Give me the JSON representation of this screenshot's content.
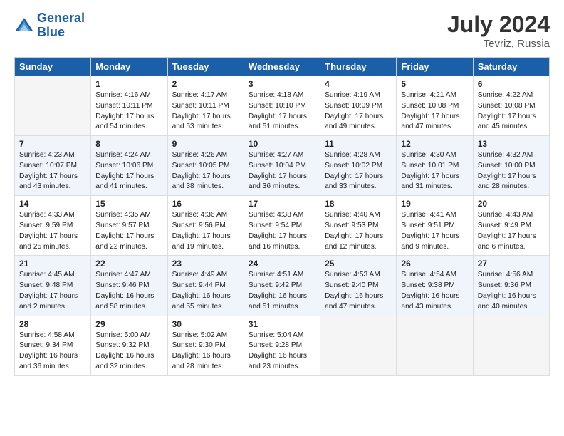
{
  "header": {
    "logo_line1": "General",
    "logo_line2": "Blue",
    "month_title": "July 2024",
    "location": "Tevriz, Russia"
  },
  "days_of_week": [
    "Sunday",
    "Monday",
    "Tuesday",
    "Wednesday",
    "Thursday",
    "Friday",
    "Saturday"
  ],
  "weeks": [
    {
      "row_class": "row-week1",
      "days": [
        {
          "num": "",
          "info": "",
          "empty": true
        },
        {
          "num": "1",
          "info": "Sunrise: 4:16 AM\nSunset: 10:11 PM\nDaylight: 17 hours\nand 54 minutes."
        },
        {
          "num": "2",
          "info": "Sunrise: 4:17 AM\nSunset: 10:11 PM\nDaylight: 17 hours\nand 53 minutes."
        },
        {
          "num": "3",
          "info": "Sunrise: 4:18 AM\nSunset: 10:10 PM\nDaylight: 17 hours\nand 51 minutes."
        },
        {
          "num": "4",
          "info": "Sunrise: 4:19 AM\nSunset: 10:09 PM\nDaylight: 17 hours\nand 49 minutes."
        },
        {
          "num": "5",
          "info": "Sunrise: 4:21 AM\nSunset: 10:08 PM\nDaylight: 17 hours\nand 47 minutes."
        },
        {
          "num": "6",
          "info": "Sunrise: 4:22 AM\nSunset: 10:08 PM\nDaylight: 17 hours\nand 45 minutes."
        }
      ]
    },
    {
      "row_class": "row-week2",
      "days": [
        {
          "num": "7",
          "info": "Sunrise: 4:23 AM\nSunset: 10:07 PM\nDaylight: 17 hours\nand 43 minutes."
        },
        {
          "num": "8",
          "info": "Sunrise: 4:24 AM\nSunset: 10:06 PM\nDaylight: 17 hours\nand 41 minutes."
        },
        {
          "num": "9",
          "info": "Sunrise: 4:26 AM\nSunset: 10:05 PM\nDaylight: 17 hours\nand 38 minutes."
        },
        {
          "num": "10",
          "info": "Sunrise: 4:27 AM\nSunset: 10:04 PM\nDaylight: 17 hours\nand 36 minutes."
        },
        {
          "num": "11",
          "info": "Sunrise: 4:28 AM\nSunset: 10:02 PM\nDaylight: 17 hours\nand 33 minutes."
        },
        {
          "num": "12",
          "info": "Sunrise: 4:30 AM\nSunset: 10:01 PM\nDaylight: 17 hours\nand 31 minutes."
        },
        {
          "num": "13",
          "info": "Sunrise: 4:32 AM\nSunset: 10:00 PM\nDaylight: 17 hours\nand 28 minutes."
        }
      ]
    },
    {
      "row_class": "row-week3",
      "days": [
        {
          "num": "14",
          "info": "Sunrise: 4:33 AM\nSunset: 9:59 PM\nDaylight: 17 hours\nand 25 minutes."
        },
        {
          "num": "15",
          "info": "Sunrise: 4:35 AM\nSunset: 9:57 PM\nDaylight: 17 hours\nand 22 minutes."
        },
        {
          "num": "16",
          "info": "Sunrise: 4:36 AM\nSunset: 9:56 PM\nDaylight: 17 hours\nand 19 minutes."
        },
        {
          "num": "17",
          "info": "Sunrise: 4:38 AM\nSunset: 9:54 PM\nDaylight: 17 hours\nand 16 minutes."
        },
        {
          "num": "18",
          "info": "Sunrise: 4:40 AM\nSunset: 9:53 PM\nDaylight: 17 hours\nand 12 minutes."
        },
        {
          "num": "19",
          "info": "Sunrise: 4:41 AM\nSunset: 9:51 PM\nDaylight: 17 hours\nand 9 minutes."
        },
        {
          "num": "20",
          "info": "Sunrise: 4:43 AM\nSunset: 9:49 PM\nDaylight: 17 hours\nand 6 minutes."
        }
      ]
    },
    {
      "row_class": "row-week4",
      "days": [
        {
          "num": "21",
          "info": "Sunrise: 4:45 AM\nSunset: 9:48 PM\nDaylight: 17 hours\nand 2 minutes."
        },
        {
          "num": "22",
          "info": "Sunrise: 4:47 AM\nSunset: 9:46 PM\nDaylight: 16 hours\nand 58 minutes."
        },
        {
          "num": "23",
          "info": "Sunrise: 4:49 AM\nSunset: 9:44 PM\nDaylight: 16 hours\nand 55 minutes."
        },
        {
          "num": "24",
          "info": "Sunrise: 4:51 AM\nSunset: 9:42 PM\nDaylight: 16 hours\nand 51 minutes."
        },
        {
          "num": "25",
          "info": "Sunrise: 4:53 AM\nSunset: 9:40 PM\nDaylight: 16 hours\nand 47 minutes."
        },
        {
          "num": "26",
          "info": "Sunrise: 4:54 AM\nSunset: 9:38 PM\nDaylight: 16 hours\nand 43 minutes."
        },
        {
          "num": "27",
          "info": "Sunrise: 4:56 AM\nSunset: 9:36 PM\nDaylight: 16 hours\nand 40 minutes."
        }
      ]
    },
    {
      "row_class": "row-week5",
      "days": [
        {
          "num": "28",
          "info": "Sunrise: 4:58 AM\nSunset: 9:34 PM\nDaylight: 16 hours\nand 36 minutes."
        },
        {
          "num": "29",
          "info": "Sunrise: 5:00 AM\nSunset: 9:32 PM\nDaylight: 16 hours\nand 32 minutes."
        },
        {
          "num": "30",
          "info": "Sunrise: 5:02 AM\nSunset: 9:30 PM\nDaylight: 16 hours\nand 28 minutes."
        },
        {
          "num": "31",
          "info": "Sunrise: 5:04 AM\nSunset: 9:28 PM\nDaylight: 16 hours\nand 23 minutes."
        },
        {
          "num": "",
          "info": "",
          "empty": true
        },
        {
          "num": "",
          "info": "",
          "empty": true
        },
        {
          "num": "",
          "info": "",
          "empty": true
        }
      ]
    }
  ]
}
